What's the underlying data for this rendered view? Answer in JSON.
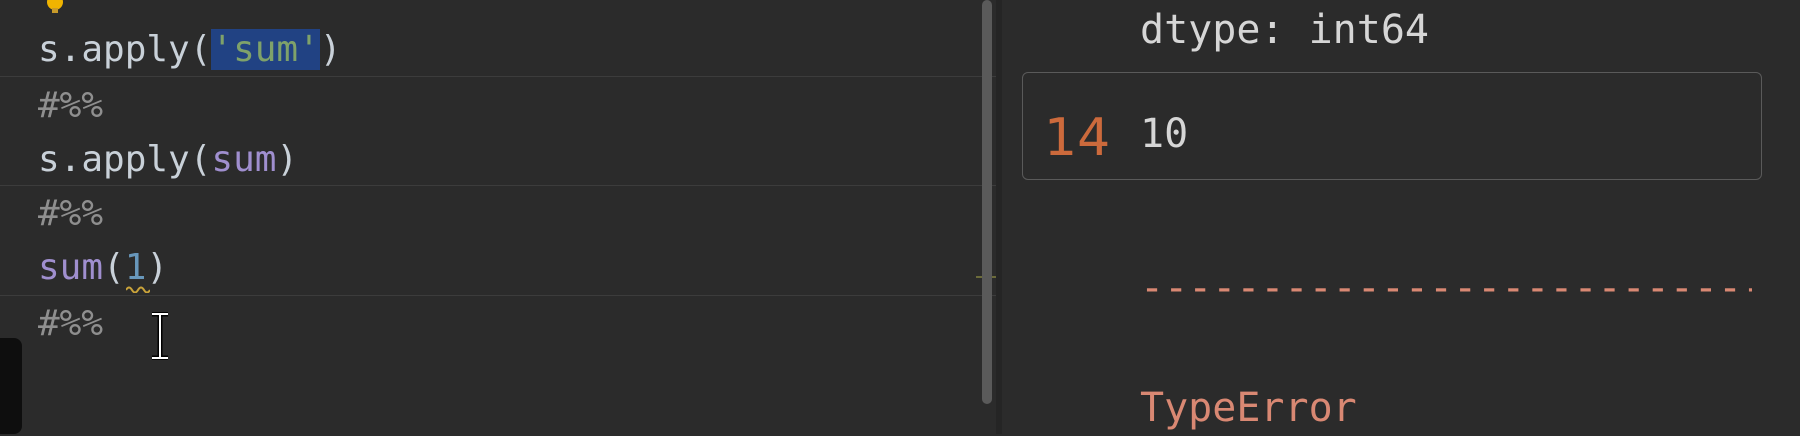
{
  "editor": {
    "lines": [
      {
        "prefix": "s.apply(",
        "string": "'sum'",
        "suffix": ")"
      },
      {
        "cell_marker": "#%%"
      },
      {
        "prefix": "s.apply(",
        "func": "sum",
        "suffix": ")"
      },
      {
        "cell_marker": "#%%"
      },
      {
        "func": "sum",
        "open": "(",
        "number": "1",
        "close": ")"
      },
      {
        "cell_marker": "#%%"
      }
    ]
  },
  "output": {
    "dtype_line": "dtype: int64",
    "cell": {
      "execution_count": "14",
      "result": "10"
    },
    "error_rule": "---------------------------",
    "error_name": "TypeError"
  },
  "colors": {
    "background": "#2b2b2b",
    "selection": "#214283",
    "string": "#7fa26a",
    "function": "#a08fcf",
    "number": "#6897bb",
    "comment": "#8f8f8f",
    "execution_count": "#cc6a3c",
    "error": "#d98873"
  }
}
